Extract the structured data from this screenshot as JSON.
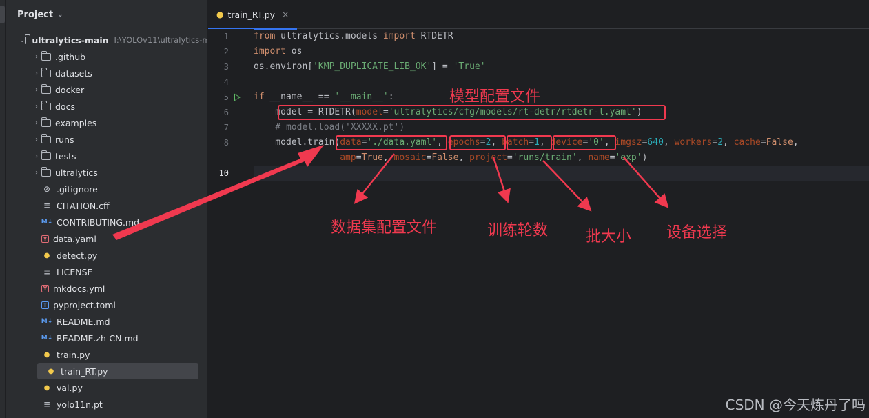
{
  "project_panel": {
    "title": "Project",
    "root": {
      "name": "ultralytics-main",
      "path": "I:\\YOLOv11\\ultralytics-m"
    },
    "items": [
      {
        "name": ".github",
        "type": "folder"
      },
      {
        "name": "datasets",
        "type": "folder"
      },
      {
        "name": "docker",
        "type": "folder"
      },
      {
        "name": "docs",
        "type": "folder"
      },
      {
        "name": "examples",
        "type": "folder"
      },
      {
        "name": "runs",
        "type": "folder"
      },
      {
        "name": "tests",
        "type": "folder"
      },
      {
        "name": "ultralytics",
        "type": "folder"
      },
      {
        "name": ".gitignore",
        "type": "ignore"
      },
      {
        "name": "CITATION.cff",
        "type": "txt"
      },
      {
        "name": "CONTRIBUTING.md",
        "type": "md"
      },
      {
        "name": "data.yaml",
        "type": "yaml"
      },
      {
        "name": "detect.py",
        "type": "py"
      },
      {
        "name": "LICENSE",
        "type": "txt"
      },
      {
        "name": "mkdocs.yml",
        "type": "yaml"
      },
      {
        "name": "pyproject.toml",
        "type": "toml"
      },
      {
        "name": "README.md",
        "type": "md"
      },
      {
        "name": "README.zh-CN.md",
        "type": "md"
      },
      {
        "name": "train.py",
        "type": "py"
      },
      {
        "name": "train_RT.py",
        "type": "py",
        "selected": true
      },
      {
        "name": "val.py",
        "type": "py"
      },
      {
        "name": "yolo11n.pt",
        "type": "txt"
      }
    ]
  },
  "editor": {
    "tab": {
      "label": "train_RT.py",
      "close": "×"
    },
    "lines": [
      {
        "n": "1",
        "tokens": [
          [
            "kw",
            "from"
          ],
          [
            "id",
            " ultralytics.models "
          ],
          [
            "kw",
            "import"
          ],
          [
            "id",
            " RTDETR"
          ]
        ]
      },
      {
        "n": "2",
        "tokens": [
          [
            "kw",
            "import"
          ],
          [
            "id",
            " os"
          ]
        ]
      },
      {
        "n": "3",
        "tokens": [
          [
            "id",
            "os.environ["
          ],
          [
            "str",
            "'KMP_DUPLICATE_LIB_OK'"
          ],
          [
            "id",
            "] = "
          ],
          [
            "str",
            "'True'"
          ]
        ]
      },
      {
        "n": "4",
        "tokens": []
      },
      {
        "n": "5",
        "tokens": [
          [
            "kw",
            "if"
          ],
          [
            "id",
            " __name__ == "
          ],
          [
            "str",
            "'__main__'"
          ],
          [
            "id",
            ":"
          ]
        ],
        "run": true
      },
      {
        "n": "6",
        "tokens": [
          [
            "id",
            "    model = RTDETR("
          ],
          [
            "param",
            "model"
          ],
          [
            "id",
            "="
          ],
          [
            "str",
            "'ultralytics/cfg/models/rt-detr/rtdetr-l.yaml'"
          ],
          [
            "id",
            ")"
          ]
        ]
      },
      {
        "n": "7",
        "tokens": [
          [
            "cm",
            "    # model.load('XXXXX.pt')"
          ]
        ]
      },
      {
        "n": "8",
        "tokens": [
          [
            "id",
            "    model.train("
          ],
          [
            "param",
            "data"
          ],
          [
            "id",
            "="
          ],
          [
            "str",
            "'./data.yaml'"
          ],
          [
            "id",
            ", "
          ],
          [
            "param",
            "epochs"
          ],
          [
            "id",
            "="
          ],
          [
            "num",
            "2"
          ],
          [
            "id",
            ", "
          ],
          [
            "param",
            "batch"
          ],
          [
            "id",
            "="
          ],
          [
            "num",
            "1"
          ],
          [
            "id",
            ", "
          ],
          [
            "param",
            "device"
          ],
          [
            "id",
            "="
          ],
          [
            "str",
            "'0'"
          ],
          [
            "id",
            ", "
          ],
          [
            "param",
            "imgsz"
          ],
          [
            "id",
            "="
          ],
          [
            "num",
            "640"
          ],
          [
            "id",
            ", "
          ],
          [
            "param",
            "workers"
          ],
          [
            "id",
            "="
          ],
          [
            "num",
            "2"
          ],
          [
            "id",
            ", "
          ],
          [
            "param",
            "cache"
          ],
          [
            "id",
            "="
          ],
          [
            "kw",
            "False"
          ],
          [
            "id",
            ","
          ]
        ]
      },
      {
        "n": "",
        "tokens": [
          [
            "id",
            "                "
          ],
          [
            "param",
            "amp"
          ],
          [
            "id",
            "="
          ],
          [
            "kw",
            "True"
          ],
          [
            "id",
            ", "
          ],
          [
            "param",
            "mosaic"
          ],
          [
            "id",
            "="
          ],
          [
            "kw",
            "False"
          ],
          [
            "id",
            ", "
          ],
          [
            "param",
            "project"
          ],
          [
            "id",
            "="
          ],
          [
            "str",
            "'runs/train'"
          ],
          [
            "id",
            ", "
          ],
          [
            "param",
            "name"
          ],
          [
            "id",
            "="
          ],
          [
            "str",
            "'exp'"
          ],
          [
            "id",
            ")"
          ]
        ]
      },
      {
        "n": "10",
        "tokens": [],
        "current": true
      }
    ]
  },
  "annotations": {
    "model_cfg": "模型配置文件",
    "dataset_cfg": "数据集配置文件",
    "epochs": "训练轮数",
    "batch": "批大小",
    "device": "设备选择"
  },
  "watermark": "CSDN @今天炼丹了吗",
  "colors": {
    "highlight": "#f0394f",
    "accent": "#3574f0"
  }
}
